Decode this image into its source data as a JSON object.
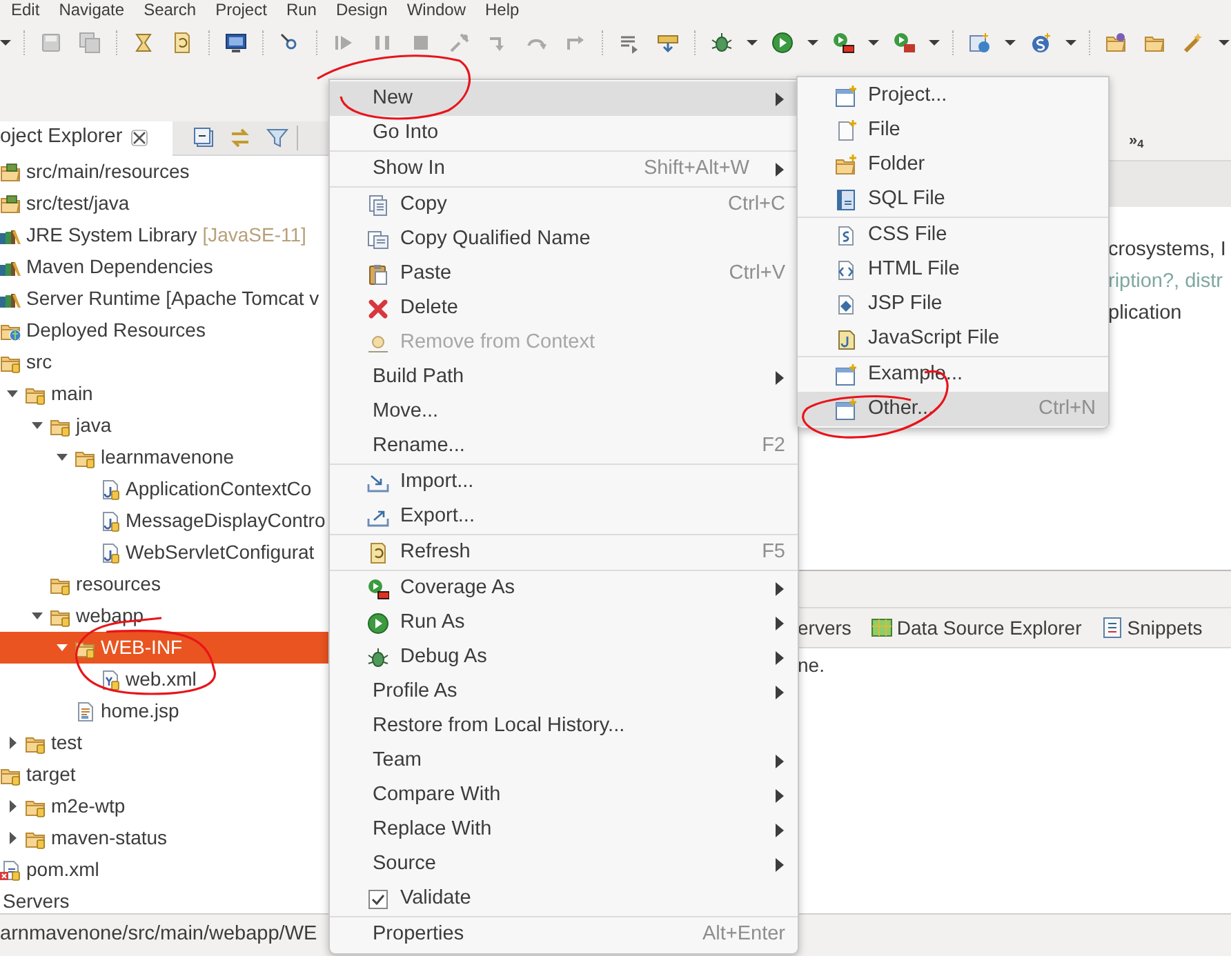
{
  "menu_bar": [
    "Edit",
    "Navigate",
    "Search",
    "Project",
    "Run",
    "Design",
    "Window",
    "Help"
  ],
  "project_explorer": {
    "title": "oject Explorer",
    "tree": [
      {
        "label": "src/main/resources",
        "kind": "source-folder",
        "selected": false
      },
      {
        "label": "src/test/java",
        "kind": "source-folder",
        "selected": false
      },
      {
        "label": "JRE System Library",
        "decoration": "[JavaSE-11]",
        "kind": "library",
        "selected": false
      },
      {
        "label": "Maven Dependencies",
        "kind": "library",
        "selected": false
      },
      {
        "label": "Server Runtime [Apache Tomcat v",
        "kind": "library",
        "selected": false
      },
      {
        "label": "Deployed Resources",
        "kind": "deployed",
        "selected": false
      },
      {
        "label": "src",
        "kind": "folder",
        "selected": false,
        "children": [
          {
            "label": "main",
            "kind": "folder",
            "expanded": true,
            "selected": false,
            "children": [
              {
                "label": "java",
                "kind": "folder",
                "expanded": true,
                "selected": false,
                "children": [
                  {
                    "label": "learnmavenone",
                    "kind": "folder",
                    "expanded": true,
                    "selected": false,
                    "children": [
                      {
                        "label": "ApplicationContextCo",
                        "kind": "java-file",
                        "selected": false
                      },
                      {
                        "label": "MessageDisplayContro",
                        "kind": "java-file",
                        "selected": false
                      },
                      {
                        "label": "WebServletConfigurat",
                        "kind": "java-file",
                        "selected": false
                      }
                    ]
                  }
                ]
              },
              {
                "label": "resources",
                "kind": "folder",
                "selected": false
              },
              {
                "label": "webapp",
                "kind": "folder",
                "expanded": true,
                "selected": false,
                "children": [
                  {
                    "label": "WEB-INF",
                    "kind": "folder",
                    "expanded": true,
                    "selected": true,
                    "children": [
                      {
                        "label": "web.xml",
                        "kind": "xml-file",
                        "selected": false
                      }
                    ]
                  },
                  {
                    "label": "home.jsp",
                    "kind": "jsp-file",
                    "selected": false
                  }
                ]
              }
            ]
          },
          {
            "label": "test",
            "kind": "folder",
            "expanded": false,
            "selected": false
          }
        ]
      },
      {
        "label": "target",
        "kind": "folder",
        "selected": false,
        "children": [
          {
            "label": "m2e-wtp",
            "kind": "folder",
            "expanded": false,
            "selected": false
          },
          {
            "label": "maven-status",
            "kind": "folder",
            "expanded": false,
            "selected": false
          }
        ]
      },
      {
        "label": "pom.xml",
        "kind": "pom-file",
        "selected": false
      },
      {
        "label": "Servers",
        "kind": "project",
        "selected": false
      }
    ]
  },
  "editor": {
    "tab_overflow": "»$_{4}$",
    "lines": [
      {
        "text": "crosystems, I",
        "kind": "plain"
      },
      {
        "text": "ription?, distr",
        "kind": "hint"
      },
      {
        "text": "plication",
        "kind": "plain"
      }
    ]
  },
  "bottom_panel": {
    "tabs": [
      {
        "label": "ervers"
      },
      {
        "label": "Data Source Explorer"
      },
      {
        "label": "Snippets"
      }
    ],
    "message": "ne."
  },
  "status_bar": "arnmavenone/src/main/webapp/WE",
  "context_menu": {
    "items": [
      {
        "kind": "item",
        "label": "New",
        "submenu": true,
        "selected": true,
        "disabled": false
      },
      {
        "kind": "item",
        "label": "Go Into",
        "submenu": false,
        "selected": false,
        "disabled": false
      },
      {
        "kind": "separator"
      },
      {
        "kind": "item",
        "label": "Show In",
        "shortcut": "Shift+Alt+W",
        "submenu": true,
        "selected": false,
        "disabled": false
      },
      {
        "kind": "separator"
      },
      {
        "kind": "item",
        "label": "Copy",
        "shortcut": "Ctrl+C",
        "submenu": false,
        "selected": false,
        "disabled": false
      },
      {
        "kind": "item",
        "label": "Copy Qualified Name",
        "submenu": false,
        "selected": false,
        "disabled": false
      },
      {
        "kind": "item",
        "label": "Paste",
        "shortcut": "Ctrl+V",
        "submenu": false,
        "selected": false,
        "disabled": false
      },
      {
        "kind": "item",
        "label": "Delete",
        "submenu": false,
        "selected": false,
        "disabled": false
      },
      {
        "kind": "item",
        "label": "Remove from Context",
        "submenu": false,
        "selected": false,
        "disabled": true
      },
      {
        "kind": "item",
        "label": "Build Path",
        "submenu": true,
        "selected": false,
        "disabled": false
      },
      {
        "kind": "item",
        "label": "Move...",
        "submenu": false,
        "selected": false,
        "disabled": false
      },
      {
        "kind": "item",
        "label": "Rename...",
        "shortcut": "F2",
        "submenu": false,
        "selected": false,
        "disabled": false
      },
      {
        "kind": "separator"
      },
      {
        "kind": "item",
        "label": "Import...",
        "submenu": false,
        "selected": false,
        "disabled": false
      },
      {
        "kind": "item",
        "label": "Export...",
        "submenu": false,
        "selected": false,
        "disabled": false
      },
      {
        "kind": "separator"
      },
      {
        "kind": "item",
        "label": "Refresh",
        "shortcut": "F5",
        "submenu": false,
        "selected": false,
        "disabled": false
      },
      {
        "kind": "separator"
      },
      {
        "kind": "item",
        "label": "Coverage As",
        "submenu": true,
        "selected": false,
        "disabled": false
      },
      {
        "kind": "item",
        "label": "Run As",
        "submenu": true,
        "selected": false,
        "disabled": false
      },
      {
        "kind": "item",
        "label": "Debug As",
        "submenu": true,
        "selected": false,
        "disabled": false
      },
      {
        "kind": "item",
        "label": "Profile As",
        "submenu": true,
        "selected": false,
        "disabled": false
      },
      {
        "kind": "item",
        "label": "Restore from Local History...",
        "submenu": false,
        "selected": false,
        "disabled": false
      },
      {
        "kind": "item",
        "label": "Team",
        "submenu": true,
        "selected": false,
        "disabled": false
      },
      {
        "kind": "item",
        "label": "Compare With",
        "submenu": true,
        "selected": false,
        "disabled": false
      },
      {
        "kind": "item",
        "label": "Replace With",
        "submenu": true,
        "selected": false,
        "disabled": false
      },
      {
        "kind": "item",
        "label": "Source",
        "submenu": true,
        "selected": false,
        "disabled": false
      },
      {
        "kind": "check",
        "label": "Validate",
        "checked": true,
        "submenu": false,
        "selected": false,
        "disabled": false
      },
      {
        "kind": "separator"
      },
      {
        "kind": "item",
        "label": "Properties",
        "shortcut": "Alt+Enter",
        "submenu": false,
        "selected": false,
        "disabled": false
      }
    ]
  },
  "new_submenu": {
    "items": [
      {
        "kind": "item",
        "label": "Project...",
        "selected": false
      },
      {
        "kind": "item",
        "label": "File",
        "selected": false
      },
      {
        "kind": "item",
        "label": "Folder",
        "selected": false
      },
      {
        "kind": "item",
        "label": "SQL File",
        "selected": false
      },
      {
        "kind": "separator"
      },
      {
        "kind": "item",
        "label": "CSS File",
        "selected": false
      },
      {
        "kind": "item",
        "label": "HTML File",
        "selected": false
      },
      {
        "kind": "item",
        "label": "JSP File",
        "selected": false
      },
      {
        "kind": "item",
        "label": "JavaScript File",
        "selected": false
      },
      {
        "kind": "separator"
      },
      {
        "kind": "item",
        "label": "Example...",
        "selected": false
      },
      {
        "kind": "item",
        "label": "Other...",
        "shortcut": "Ctrl+N",
        "selected": true
      }
    ]
  }
}
